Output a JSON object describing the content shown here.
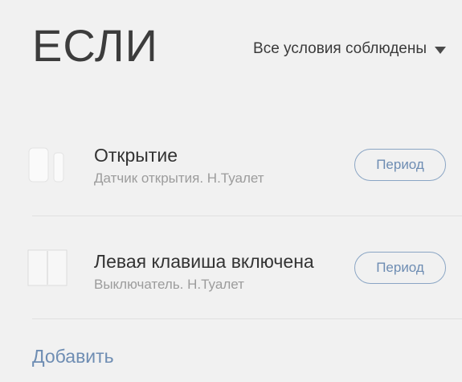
{
  "header": {
    "title": "ЕСЛИ",
    "condition_mode": "Все условия соблюдены"
  },
  "conditions": [
    {
      "title": "Открытие",
      "subtitle": "Датчик открытия. Н.Туалет",
      "button_label": "Период",
      "icon": "door-sensor-icon"
    },
    {
      "title": "Левая клавиша включена",
      "subtitle": "Выключатель. Н.Туалет",
      "button_label": "Период",
      "icon": "wall-switch-icon"
    }
  ],
  "footer": {
    "add_label": "Добавить"
  },
  "colors": {
    "background": "#f1f1f1",
    "accent": "#6e8db3",
    "text_primary": "#333333",
    "text_secondary": "#9c9c9c"
  }
}
